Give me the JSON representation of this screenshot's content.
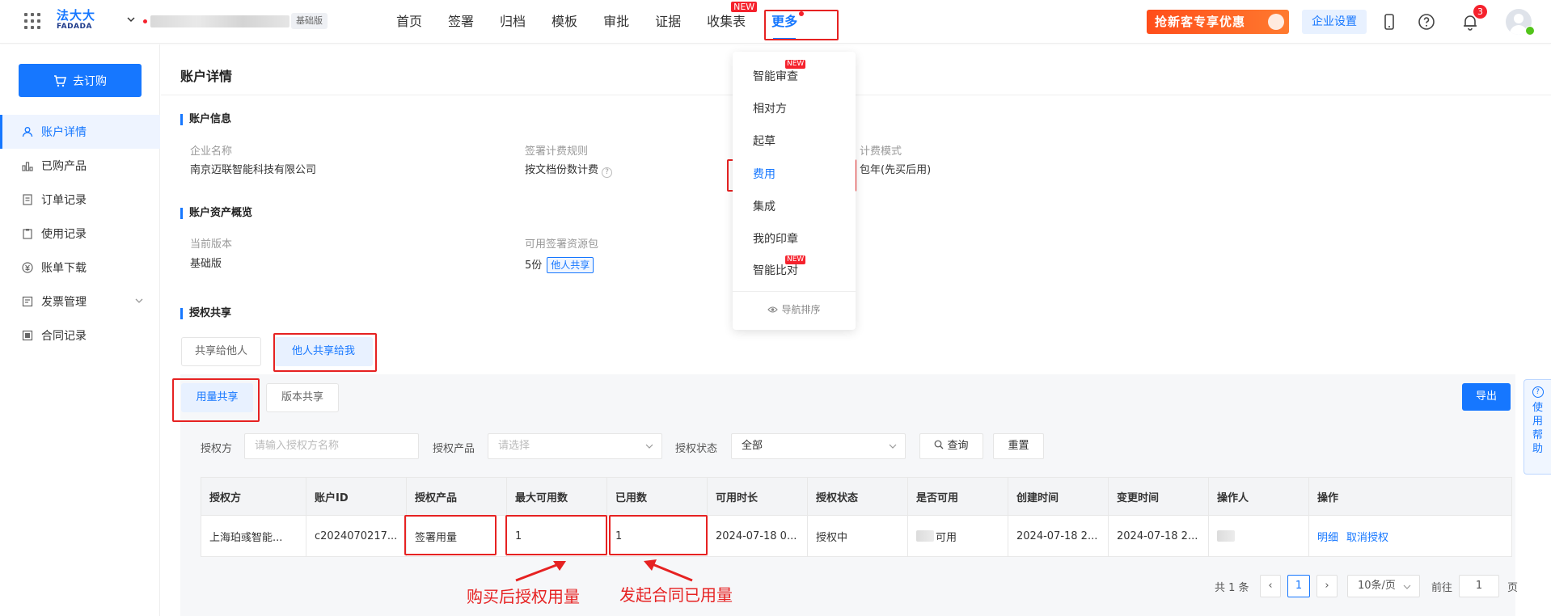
{
  "header": {
    "logo_cn": "法大大",
    "logo_en": "FADADA",
    "edition_tag": "基础版",
    "nav": [
      {
        "label": "首页"
      },
      {
        "label": "签署"
      },
      {
        "label": "归档"
      },
      {
        "label": "模板"
      },
      {
        "label": "审批"
      },
      {
        "label": "证据"
      },
      {
        "label": "收集表",
        "badge": "NEW"
      },
      {
        "label": "更多"
      }
    ],
    "promo_text": "抢新客专享优惠",
    "settings_label": "企业设置",
    "notification_count": "3"
  },
  "sidebar": {
    "order_button": "去订购",
    "items": [
      {
        "label": "账户详情"
      },
      {
        "label": "已购产品"
      },
      {
        "label": "订单记录"
      },
      {
        "label": "使用记录"
      },
      {
        "label": "账单下载"
      },
      {
        "label": "发票管理"
      },
      {
        "label": "合同记录"
      }
    ]
  },
  "page": {
    "title": "账户详情",
    "account_info": {
      "title": "账户信息",
      "company_label": "企业名称",
      "company_value": "南京迈联智能科技有限公司",
      "rule_label": "签署计费规则",
      "rule_value": "按文档份数计费",
      "mode_label": "计费模式",
      "mode_value": "包年(先买后用)"
    },
    "assets": {
      "title": "账户资产概览",
      "version_label": "当前版本",
      "version_value": "基础版",
      "pack_label": "可用签署资源包",
      "pack_value": "5份",
      "pack_tag": "他人共享"
    },
    "share": {
      "title": "授权共享",
      "tabs": [
        "共享给他人",
        "他人共享给我"
      ],
      "subtabs": [
        "用量共享",
        "版本共享"
      ],
      "export_label": "导出"
    },
    "filters": {
      "authorizer_label": "授权方",
      "authorizer_placeholder": "请输入授权方名称",
      "product_label": "授权产品",
      "product_placeholder": "请选择",
      "status_label": "授权状态",
      "status_value": "全部",
      "query_label": "查询",
      "reset_label": "重置"
    },
    "table": {
      "headers": [
        "授权方",
        "账户ID",
        "授权产品",
        "最大可用数",
        "已用数",
        "可用时长",
        "授权状态",
        "是否可用",
        "创建时间",
        "变更时间",
        "操作人",
        "操作"
      ],
      "rows": [
        [
          "上海珀彧智能...",
          "c2024070217...",
          "签署用量",
          "1",
          "1",
          "2024-07-18 0...",
          "授权中",
          "可用",
          "2024-07-18 2...",
          "2024-07-18 2...",
          "",
          ""
        ]
      ],
      "actions": [
        "明细",
        "取消授权"
      ]
    },
    "pagination": {
      "total": "共 1 条",
      "current_page": "1",
      "page_size": "10条/页",
      "goto_label": "前往",
      "goto_value": "1",
      "page_suffix": "页"
    },
    "annotations": {
      "left": "购买后授权用量",
      "right": "发起合同已用量"
    }
  },
  "dropdown": {
    "items": [
      {
        "label": "智能审查",
        "badge": "NEW"
      },
      {
        "label": "相对方"
      },
      {
        "label": "起草"
      },
      {
        "label": "费用"
      },
      {
        "label": "集成"
      },
      {
        "label": "我的印章"
      },
      {
        "label": "智能比对",
        "badge": "NEW"
      }
    ],
    "footer": "导航排序"
  },
  "help": {
    "label": "使用帮助"
  },
  "colors": {
    "primary": "#1677ff",
    "annotation_red": "#e62222",
    "badge_red": "#f5222d"
  }
}
